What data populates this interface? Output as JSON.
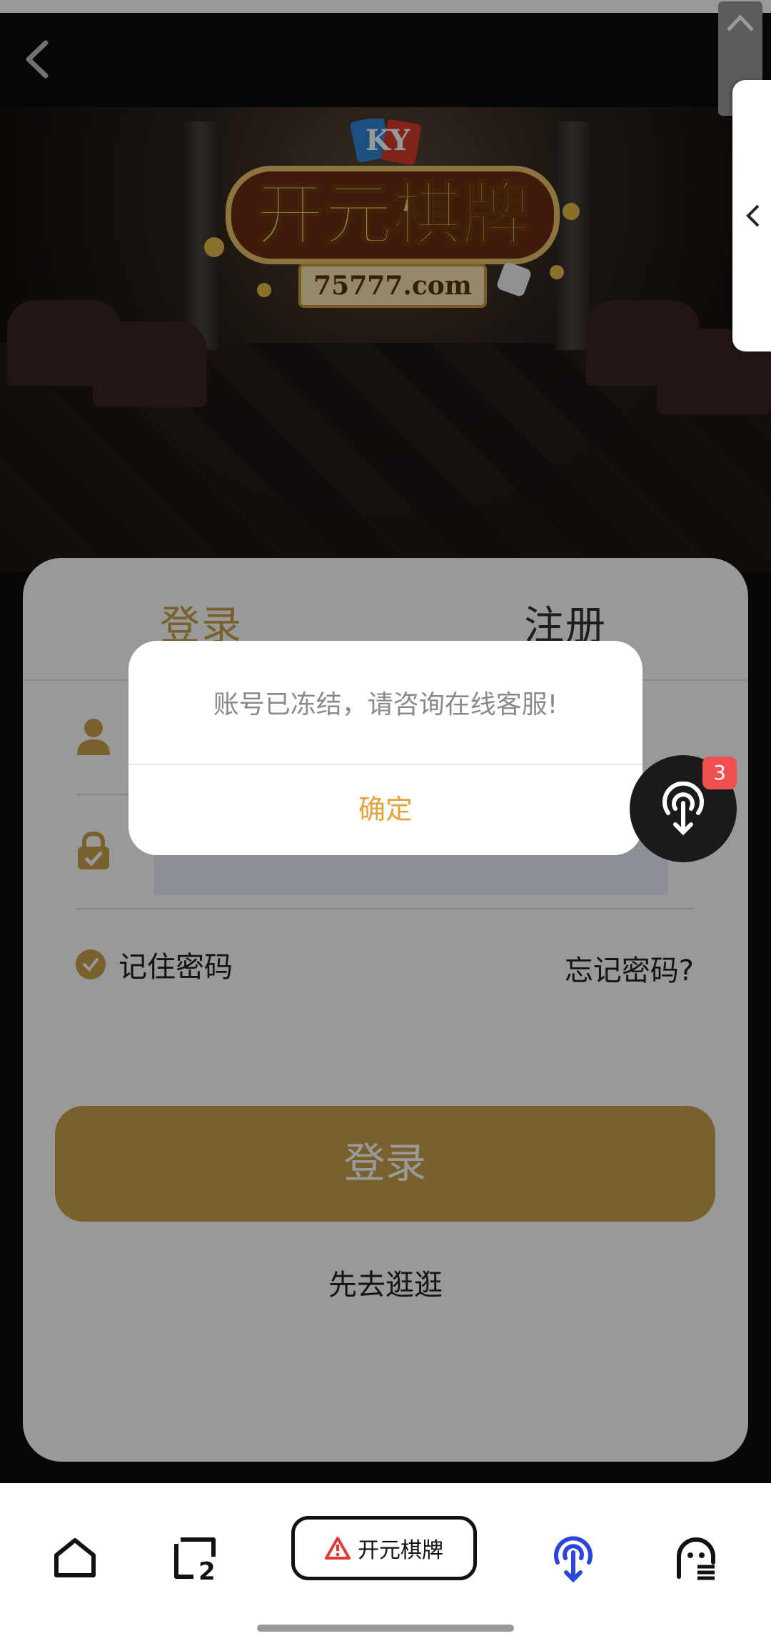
{
  "banner": {
    "logo_badge": "KY",
    "logo_title": "开元棋牌",
    "logo_domain": "75777.com"
  },
  "tabs": {
    "login": "登录",
    "register": "注册"
  },
  "form": {
    "username_placeholder": "",
    "password_placeholder": "",
    "remember_label": "记住密码",
    "forgot_label": "忘记密码?",
    "submit_label": "登录",
    "browse_label": "先去逛逛"
  },
  "dialog": {
    "message": "账号已冻结，请咨询在线客服!",
    "confirm_label": "确定"
  },
  "float_button": {
    "badge_count": "3"
  },
  "bottom_bar": {
    "site_label": "开元棋牌",
    "tabs_count": "2"
  },
  "colors": {
    "gold": "#c8a24a",
    "confirm": "#e6a23c",
    "badge": "#f05050",
    "app_icon": "#2b46d8",
    "warning": "#e53935"
  },
  "icons": [
    "back-arrow-icon",
    "user-icon",
    "lock-icon",
    "check-icon",
    "wifi-download-icon",
    "home-icon",
    "tabs-icon",
    "warning-icon",
    "ghost-menu-icon",
    "chevron-left-icon"
  ]
}
